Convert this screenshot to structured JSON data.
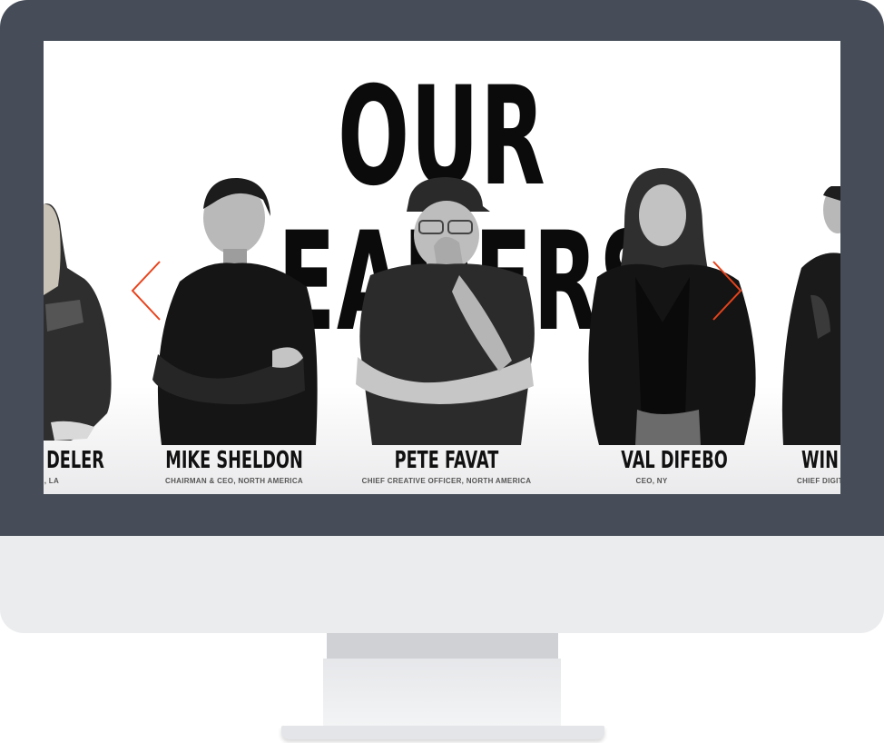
{
  "page": {
    "title": "OUR LEADERS"
  },
  "leaders": [
    {
      "name": "DELER",
      "role": "CER, LA"
    },
    {
      "name": "MIKE SHELDON",
      "role": "CHAIRMAN & CEO, NORTH AMERICA"
    },
    {
      "name": "PETE FAVAT",
      "role": "CHIEF CREATIVE OFFICER, NORTH AMERICA"
    },
    {
      "name": "VAL DIFEBO",
      "role": "CEO, NY"
    },
    {
      "name": "WIN",
      "role": "CHIEF DIGITA"
    }
  ],
  "carousel": {
    "prev_icon": "chevron-left-icon",
    "next_icon": "chevron-right-icon",
    "arrow_color": "#e8431b"
  },
  "colors": {
    "bezel": "#464d58",
    "chin": "#ebecee",
    "title": "#0b0b0b"
  }
}
